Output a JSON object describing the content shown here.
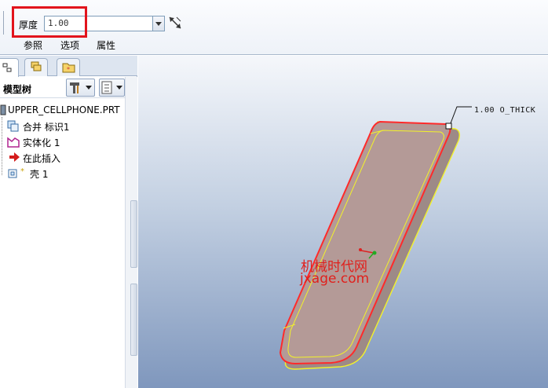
{
  "dashboard": {
    "thickness_label": "厚度",
    "thickness_value": "1.00",
    "tabs": [
      "参照",
      "选项",
      "属性"
    ],
    "highlight_color": "#e2141c",
    "flip_icon": "flip-direction-icon"
  },
  "panel": {
    "tab_icons": [
      "model-tree-tab-icon",
      "layer-tab-icon",
      "favorites-tab-icon"
    ],
    "title": "模型树",
    "tools": [
      "settings-icon",
      "show-icon"
    ],
    "tree": [
      {
        "label": "UPPER_CELLPHONE.PRT",
        "icon": "part-icon"
      },
      {
        "label": "合并 标识1",
        "icon": "merge-icon"
      },
      {
        "label": "实体化 1",
        "icon": "solidify-icon"
      },
      {
        "label": "在此插入",
        "icon": "insert-here-arrow-icon"
      },
      {
        "label": "壳 1",
        "icon": "shell-icon"
      }
    ]
  },
  "viewport": {
    "dimension_label": "1.00 O_THICK",
    "watermark_line1": "机械时代网",
    "watermark_line2": "jxage.com",
    "colors": {
      "shell_fill": "#b49a97",
      "edge_yellow": "#f2f22a",
      "edge_red": "#ff2a2a",
      "watermark": "#e0201c"
    }
  }
}
